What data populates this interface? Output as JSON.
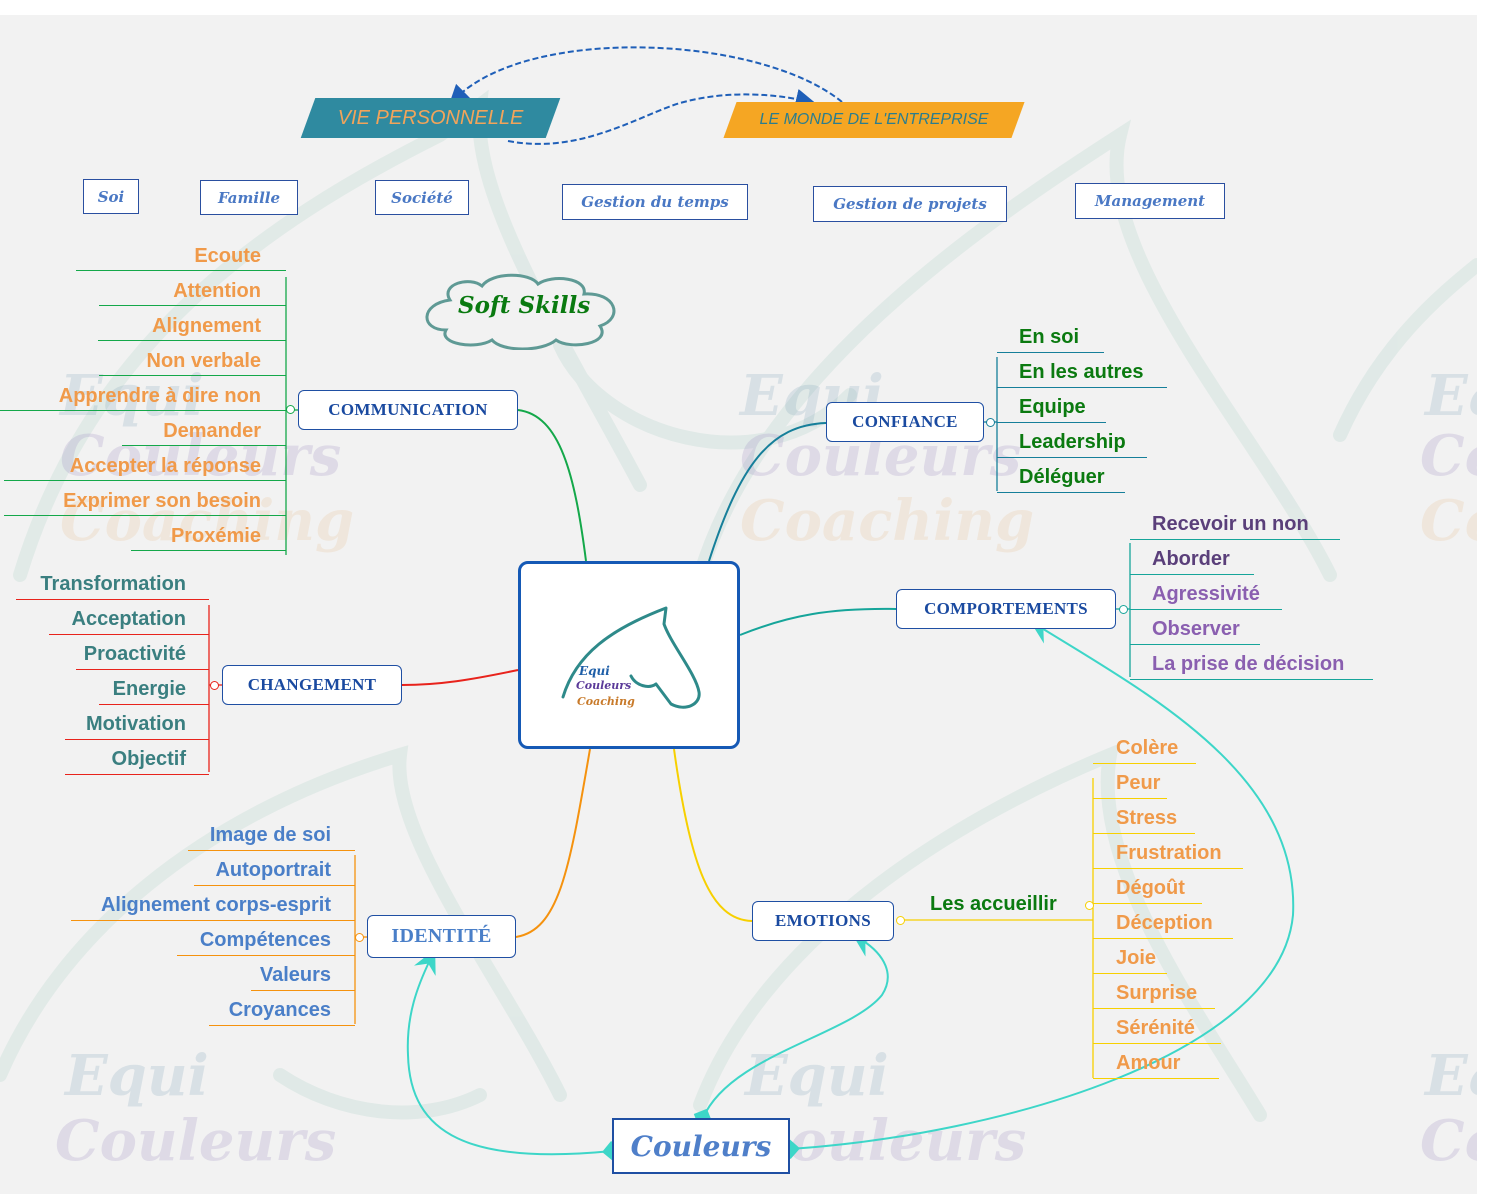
{
  "title": "Soft Skills",
  "colors": {
    "background": "#f2f2f2",
    "topic_border": "#1f4fa3",
    "topic_text": "#1a4aa0",
    "relation_link": "#3dd6c8",
    "dashed_link": "#1f5fb8"
  },
  "banners": [
    {
      "label": "VIE PERSONNELLE",
      "bg": "#2f8aa0",
      "fg": "#f2a45a"
    },
    {
      "label": "LE MONDE DE L'ENTREPRISE",
      "bg": "#f5a623",
      "fg": "#2b7d8e"
    }
  ],
  "tags": {
    "personal": [
      "Soi",
      "Famille",
      "Société"
    ],
    "business": [
      "Gestion du temps",
      "Gestion de projets",
      "Management"
    ]
  },
  "cloud": {
    "label": "Soft Skills"
  },
  "central": {
    "logo_lines": [
      "Equi",
      "Couleurs",
      "Coaching"
    ],
    "icon": "horse-head-icon"
  },
  "topics": {
    "communication": {
      "label": "COMMUNICATION",
      "color": "#14a84a",
      "text_color": "#f09a4a",
      "children": [
        "Ecoute",
        "Attention",
        "Alignement",
        "Non verbale",
        "Apprendre à dire non",
        "Demander",
        "Accepter la réponse",
        "Exprimer son besoin",
        "Proxémie"
      ]
    },
    "confiance": {
      "label": "CONFIANCE",
      "color": "#167f9a",
      "text_color": "#0b7a10",
      "children": [
        "En soi",
        "En les autres",
        "Equipe",
        "Leadership",
        "Déléguer"
      ]
    },
    "comportements": {
      "label": "COMPORTEMENTS",
      "color": "#16a59a",
      "children": [
        {
          "label": "Recevoir un non",
          "color": "#5a3f7a"
        },
        {
          "label": "Aborder",
          "color": "#5a3f7a"
        },
        {
          "label": "Agressivité",
          "color": "#8a5fb0"
        },
        {
          "label": "Observer",
          "color": "#8a5fb0"
        },
        {
          "label": "La prise de décision",
          "color": "#8a5fb0"
        }
      ]
    },
    "changement": {
      "label": "CHANGEMENT",
      "color": "#e8231c",
      "text_color": "#3a7f80",
      "children": [
        "Transformation",
        "Acceptation",
        "Proactivité",
        "Energie",
        "Motivation",
        "Objectif"
      ]
    },
    "identite": {
      "label": "IDENTITÉ",
      "color": "#f5920e",
      "text_color": "#4a7fc8",
      "children": [
        "Image de soi",
        "Autoportrait",
        "Alignement corps-esprit",
        "Compétences",
        "Valeurs",
        "Croyances"
      ]
    },
    "emotions": {
      "label": "EMOTIONS",
      "color": "#f7d000",
      "sub": {
        "label": "Les accueillir",
        "color": "#0b7a10"
      },
      "text_color": "#f09a4a",
      "children": [
        "Colère",
        "Peur",
        "Stress",
        "Frustration",
        "Dégoût",
        "Déception",
        "Joie",
        "Surprise",
        "Sérénité",
        "Amour"
      ]
    }
  },
  "couleurs": {
    "label": "Couleurs"
  },
  "watermark": {
    "lines": [
      "Equi",
      "Couleurs",
      "Coaching"
    ]
  }
}
